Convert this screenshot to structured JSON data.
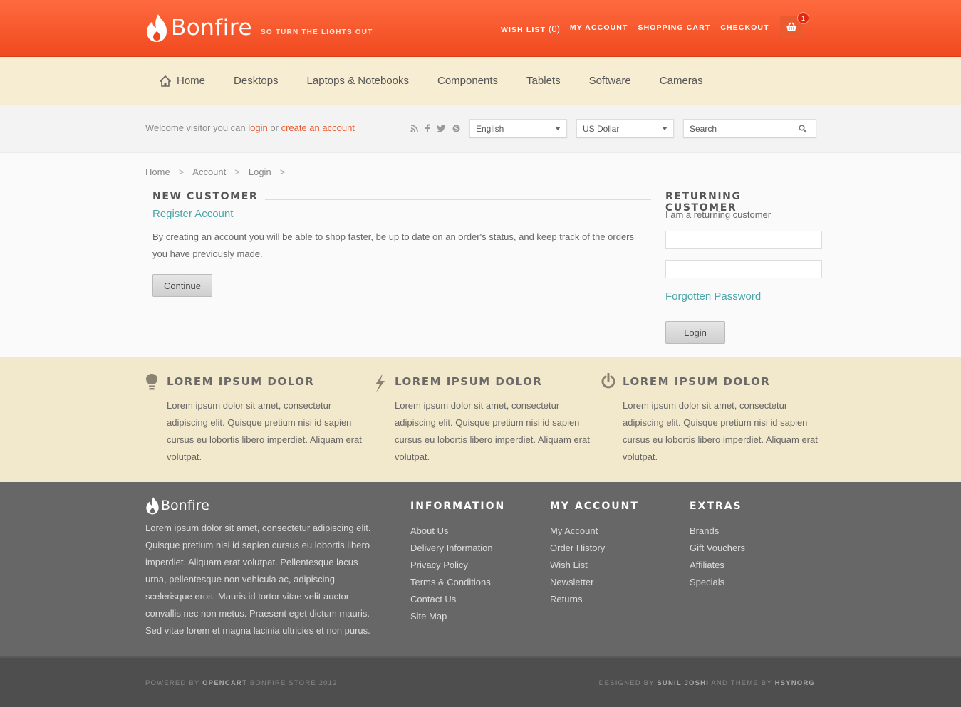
{
  "brand": {
    "name": "Bonfire",
    "tagline": "SO TURN THE LIGHTS OUT"
  },
  "topnav": {
    "wishlist_label": "WISH LIST",
    "wishlist_count": "(0)",
    "account": "MY ACCOUNT",
    "cart": "SHOPPING CART",
    "checkout": "CHECKOUT",
    "cart_badge": "1"
  },
  "mainnav": [
    "Home",
    "Desktops",
    "Laptops & Notebooks",
    "Components",
    "Tablets",
    "Software",
    "Cameras"
  ],
  "utility": {
    "welcome_prefix": "Welcome visitor you can",
    "login_link": "login",
    "or": "or",
    "create_link": "create an account",
    "language": "English",
    "currency": "US Dollar",
    "search_placeholder": "Search"
  },
  "breadcrumb": [
    "Home",
    "Account",
    "Login"
  ],
  "new_customer": {
    "heading": "NEW CUSTOMER",
    "subheading": "Register Account",
    "text": "By creating an account you will be able to shop faster, be up to date on an order's status, and keep track of the orders you have previously made.",
    "button": "Continue"
  },
  "returning": {
    "heading": "RETURNING CUSTOMER",
    "subtext": "I am a returning customer",
    "email_value": "",
    "password_value": "",
    "forgot": "Forgotten Password",
    "button": "Login"
  },
  "features": [
    {
      "icon": "lightbulb-icon",
      "title": "LOREM IPSUM DOLOR",
      "text": "Lorem ipsum dolor sit amet, consectetur adipiscing elit. Quisque pretium nisi id sapien cursus eu lobortis libero imperdiet. Aliquam erat volutpat."
    },
    {
      "icon": "lightning-icon",
      "title": "LOREM IPSUM DOLOR",
      "text": "Lorem ipsum dolor sit amet, consectetur adipiscing elit. Quisque pretium nisi id sapien cursus eu lobortis libero imperdiet. Aliquam erat volutpat."
    },
    {
      "icon": "power-icon",
      "title": "LOREM IPSUM DOLOR",
      "text": "Lorem ipsum dolor sit amet, consectetur adipiscing elit. Quisque pretium nisi id sapien cursus eu lobortis libero imperdiet. Aliquam erat volutpat."
    }
  ],
  "footer": {
    "about": "Lorem ipsum dolor sit amet, consectetur adipiscing elit. Quisque pretium nisi id sapien cursus eu lobortis libero imperdiet. Aliquam erat volutpat. Pellentesque lacus urna, pellentesque non vehicula ac, adipiscing scelerisque eros. Mauris id tortor vitae velit auctor convallis nec non metus. Praesent eget dictum mauris. Sed vitae lorem et magna lacinia ultricies et non purus.",
    "columns": [
      {
        "title": "INFORMATION",
        "items": [
          "About Us",
          "Delivery Information",
          "Privacy Policy",
          "Terms & Conditions",
          "Contact Us",
          "Site Map"
        ]
      },
      {
        "title": "MY ACCOUNT",
        "items": [
          "My Account",
          "Order History",
          "Wish List",
          "Newsletter",
          "Returns"
        ]
      },
      {
        "title": "EXTRAS",
        "items": [
          "Brands",
          "Gift Vouchers",
          "Affiliates",
          "Specials"
        ]
      }
    ],
    "powered_prefix": "POWERED BY",
    "powered_brand": "OPENCART",
    "powered_suffix": "BONFIRE STORE 2012",
    "designed_prefix": "DESIGNED BY",
    "designed_name": "SUNIL JOSHI",
    "designed_mid": "AND THEME BY",
    "designed_theme": "HSYNORG"
  },
  "colors": {
    "accent": "#f0491f",
    "teal": "#4aa6a8",
    "cream": "#f2e8cb",
    "footer": "#676767"
  }
}
